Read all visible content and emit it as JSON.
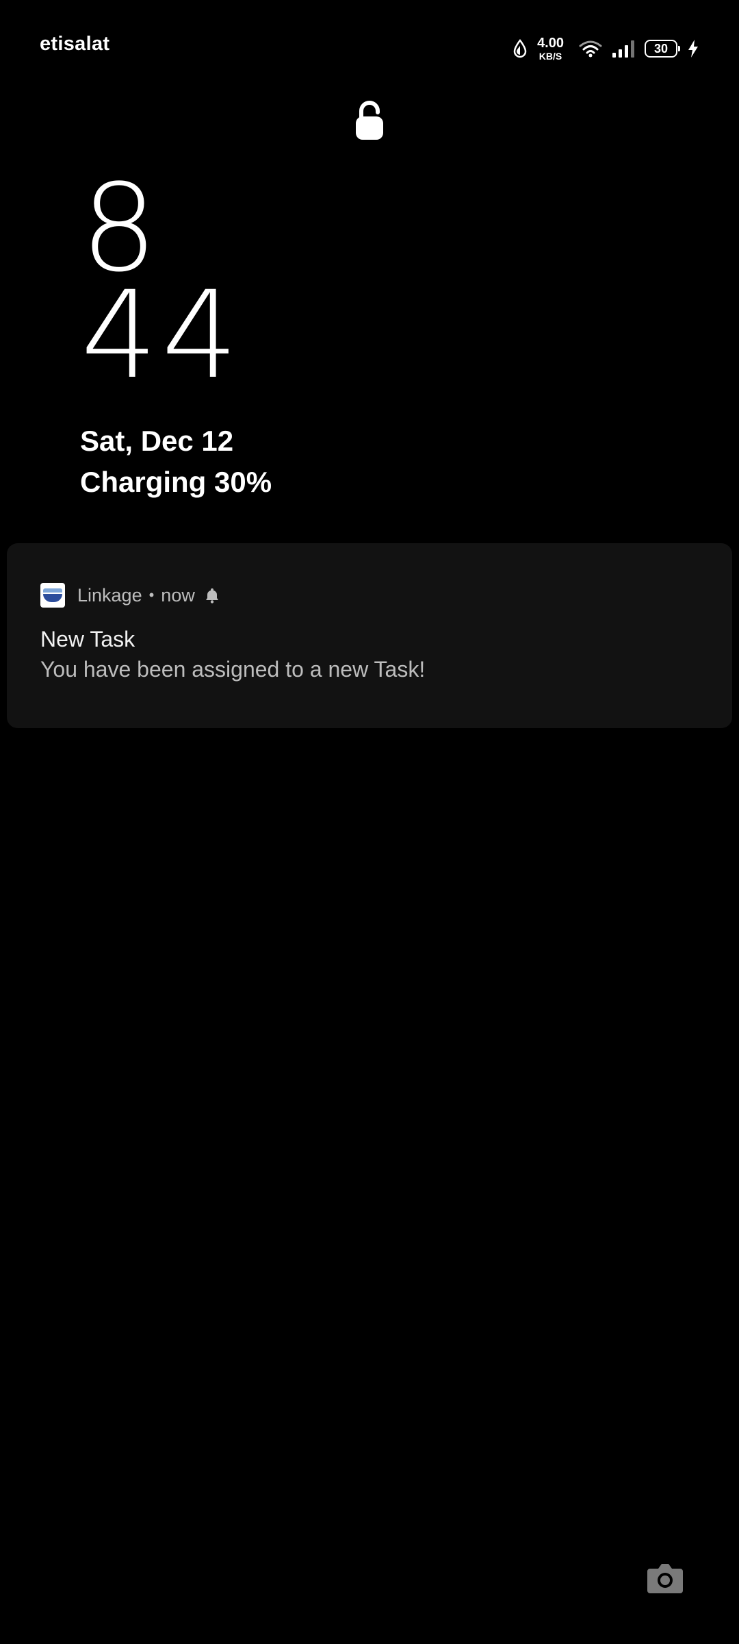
{
  "status_bar": {
    "carrier": "etisalat",
    "net_speed_value": "4.00",
    "net_speed_unit": "KB/S",
    "battery_percent": "30",
    "icons": [
      "data-saver-icon",
      "wifi-icon",
      "signal-icon",
      "battery-icon",
      "charging-bolt-icon"
    ]
  },
  "lock": {
    "icon": "unlocked-padlock-icon"
  },
  "clock": {
    "hour": "8",
    "minute": "44"
  },
  "date": "Sat, Dec 12",
  "charging": "Charging 30%",
  "notification": {
    "app_name": "Linkage",
    "separator": "•",
    "time": "now",
    "title": "New Task",
    "body": "You have been assigned to a new Task!",
    "icons": [
      "linkage-app-icon",
      "bell-icon"
    ]
  },
  "camera": {
    "icon": "camera-icon"
  },
  "colors": {
    "background": "#000000",
    "card": "#121212",
    "text_primary": "#ffffff",
    "text_secondary": "#bdbdbd"
  }
}
